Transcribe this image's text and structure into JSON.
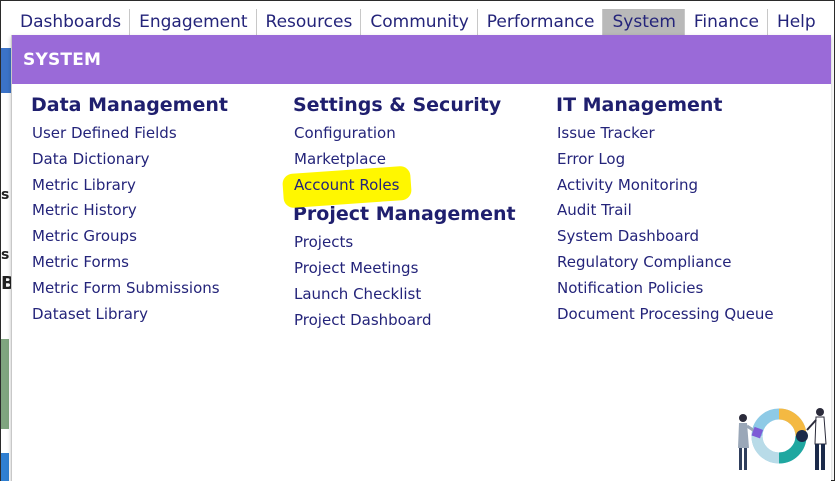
{
  "topnav": {
    "items": [
      {
        "label": "Dashboards",
        "active": false
      },
      {
        "label": "Engagement",
        "active": false
      },
      {
        "label": "Resources",
        "active": false
      },
      {
        "label": "Community",
        "active": false
      },
      {
        "label": "Performance",
        "active": false
      },
      {
        "label": "System",
        "active": true
      },
      {
        "label": "Finance",
        "active": false
      },
      {
        "label": "Help",
        "active": false
      }
    ]
  },
  "panel": {
    "header": "SYSTEM",
    "columns": [
      {
        "sections": [
          {
            "title": "Data Management",
            "links": [
              "User Defined Fields",
              "Data Dictionary",
              "Metric Library",
              "Metric History",
              "Metric Groups",
              "Metric Forms",
              "Metric Form Submissions",
              "Dataset Library"
            ]
          }
        ]
      },
      {
        "sections": [
          {
            "title": "Settings & Security",
            "links": [
              "Configuration",
              "Marketplace",
              "Account Roles"
            ]
          },
          {
            "title": "Project Management",
            "links": [
              "Projects",
              "Project Meetings",
              "Launch Checklist",
              "Project Dashboard"
            ]
          }
        ]
      },
      {
        "sections": [
          {
            "title": "IT Management",
            "links": [
              "Issue Tracker",
              "Error Log",
              "Activity Monitoring",
              "Audit Trail",
              "System Dashboard",
              "Regulatory Compliance",
              "Notification Policies",
              "Document Processing Queue"
            ]
          }
        ]
      }
    ],
    "highlighted_link": "Account Roles"
  },
  "background_page": {
    "edge_chars": [
      "s",
      "B",
      "s"
    ]
  },
  "colors": {
    "header_bg": "#9a6ad8",
    "active_tab_bg": "#b9b9b9",
    "link_text": "#24247a",
    "highlight": "#fff700"
  }
}
